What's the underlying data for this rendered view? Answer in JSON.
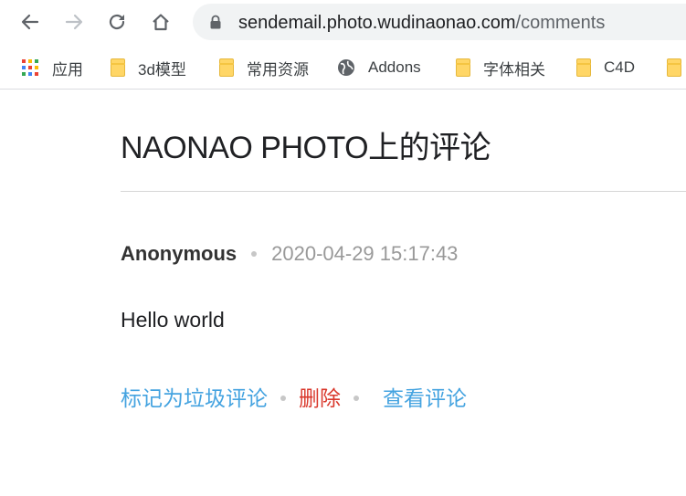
{
  "browser": {
    "url_host": "sendemail.photo.wudinaonao.com",
    "url_path": "/comments"
  },
  "bookmarks": [
    {
      "label": "应用",
      "icon": "apps-grid-icon"
    },
    {
      "label": "3d模型",
      "icon": "folder-icon"
    },
    {
      "label": "常用资源",
      "icon": "folder-icon"
    },
    {
      "label": "Addons",
      "icon": "globe-icon"
    },
    {
      "label": "字体相关",
      "icon": "folder-icon"
    },
    {
      "label": "C4D",
      "icon": "folder-icon"
    }
  ],
  "page": {
    "title": "NAONAO PHOTO上的评论"
  },
  "comment": {
    "author": "Anonymous",
    "date": "2020-04-29 15:17:43",
    "body": "Hello world"
  },
  "actions": {
    "spam": "标记为垃圾评论",
    "delete": "删除",
    "view": "查看评论"
  },
  "colors": {
    "link": "#44a3e0",
    "danger": "#d9372b",
    "muted": "#999999"
  }
}
